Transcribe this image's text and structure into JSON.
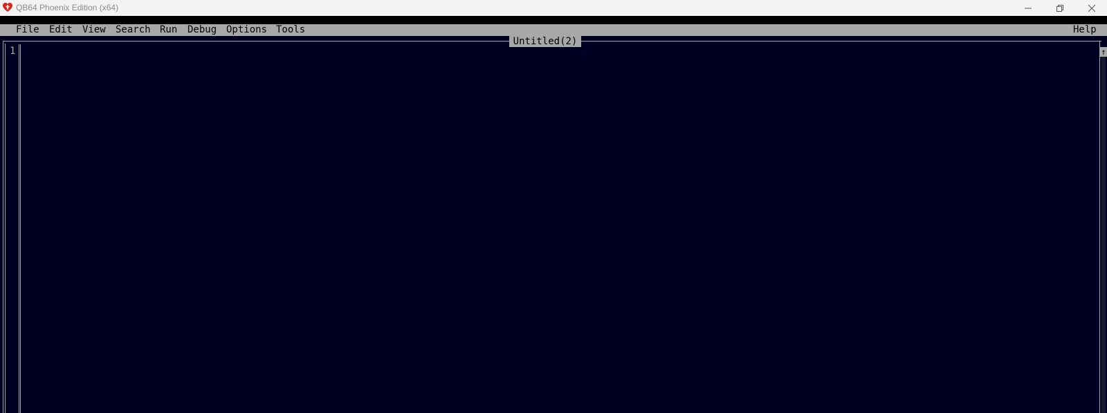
{
  "window": {
    "title": "QB64 Phoenix Edition (x64)",
    "icon": "qb64-phoenix-icon"
  },
  "menubar": {
    "items": [
      {
        "label": "File"
      },
      {
        "label": "Edit"
      },
      {
        "label": "View"
      },
      {
        "label": "Search"
      },
      {
        "label": "Run"
      },
      {
        "label": "Debug"
      },
      {
        "label": "Options"
      },
      {
        "label": "Tools"
      }
    ],
    "help": "Help"
  },
  "editor": {
    "file_title": "Untitled(2)",
    "line_number": "1",
    "scroll_up_glyph": "↑"
  },
  "colors": {
    "editor_background": "#000022",
    "menubar": "#a8a8a8",
    "frame": "#a8a8a8",
    "icon_red": "#d9251c"
  }
}
